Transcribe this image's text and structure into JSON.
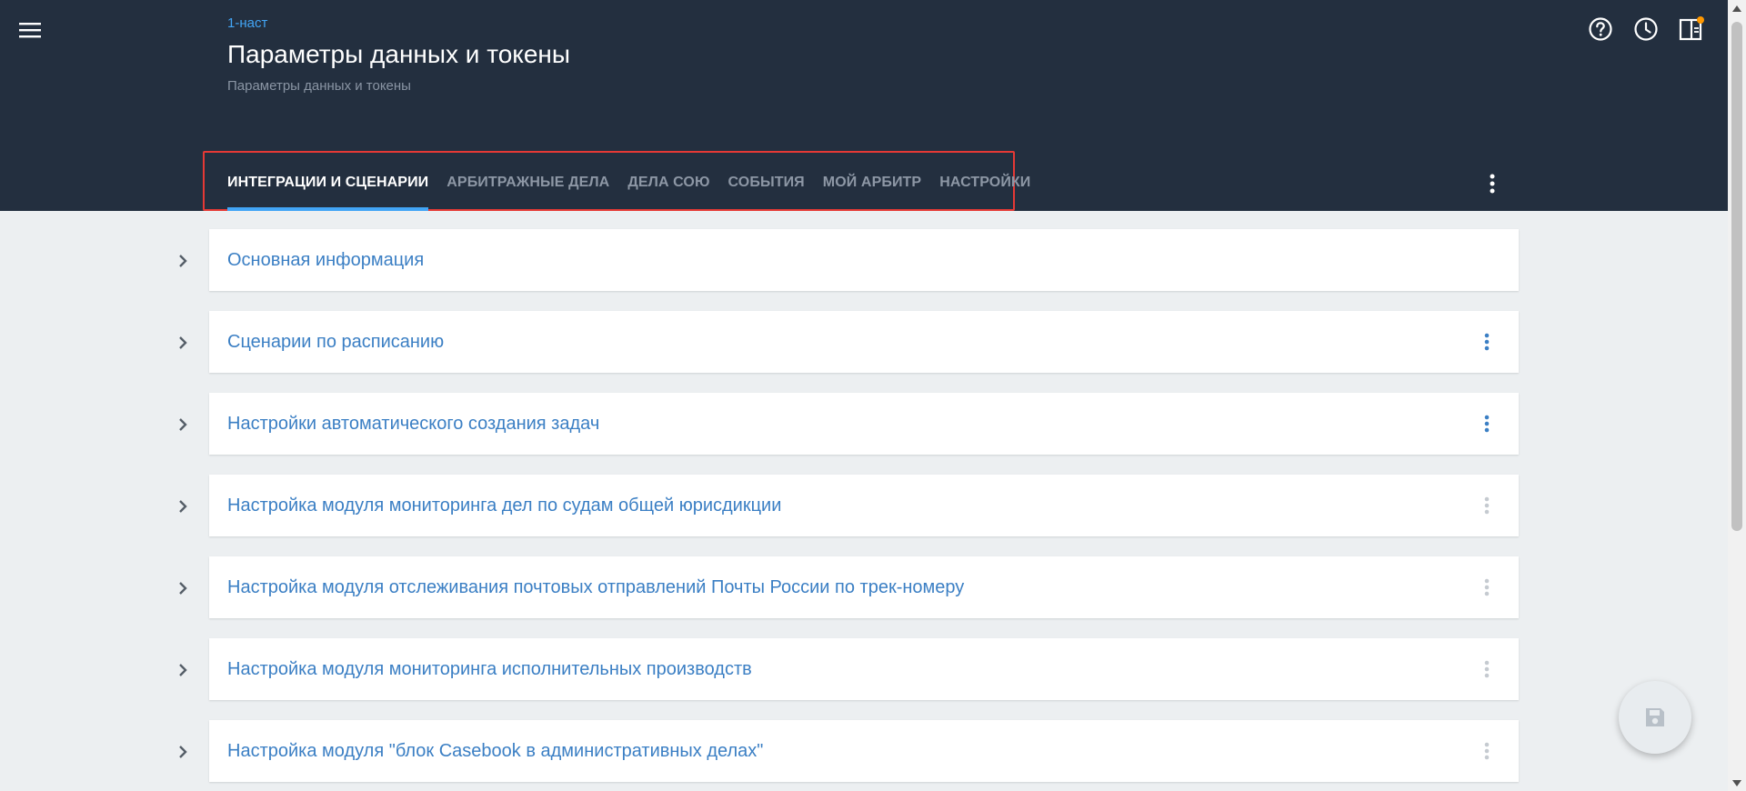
{
  "header": {
    "breadcrumb": "1-наст",
    "title": "Параметры данных и токены",
    "subtitle": "Параметры данных и токены",
    "background_color": "#232f3f",
    "icons": [
      "menu-icon",
      "help-icon",
      "history-icon",
      "panel-toggle-icon"
    ],
    "notification_dot_color": "#ff9800"
  },
  "tabs": [
    {
      "label": "ИНТЕГРАЦИИ И СЦЕНАРИИ",
      "active": true
    },
    {
      "label": "АРБИТРАЖНЫЕ ДЕЛА",
      "active": false
    },
    {
      "label": "ДЕЛА СОЮ",
      "active": false
    },
    {
      "label": "СОБЫТИЯ",
      "active": false
    },
    {
      "label": "МОЙ АРБИТР",
      "active": false
    },
    {
      "label": "НАСТРОЙКИ",
      "active": false
    }
  ],
  "tab_indicator_color": "#42a5f5",
  "highlight_color": "#e53935",
  "sections": [
    {
      "title": "Основная информация",
      "menu": "none"
    },
    {
      "title": "Сценарии по расписанию",
      "menu": "active"
    },
    {
      "title": "Настройки автоматического создания задач",
      "menu": "active"
    },
    {
      "title": "Настройка модуля мониторинга дел по судам общей юрисдикции",
      "menu": "disabled"
    },
    {
      "title": "Настройка модуля отслеживания почтовых отправлений Почты России по трек-номеру",
      "menu": "disabled"
    },
    {
      "title": "Настройка модуля мониторинга исполнительных производств",
      "menu": "disabled"
    },
    {
      "title": "Настройка модуля \"блок Casebook в административных делах\"",
      "menu": "disabled"
    }
  ],
  "section_title_color": "#3b7fc4",
  "fab": {
    "icon": "save-icon"
  }
}
